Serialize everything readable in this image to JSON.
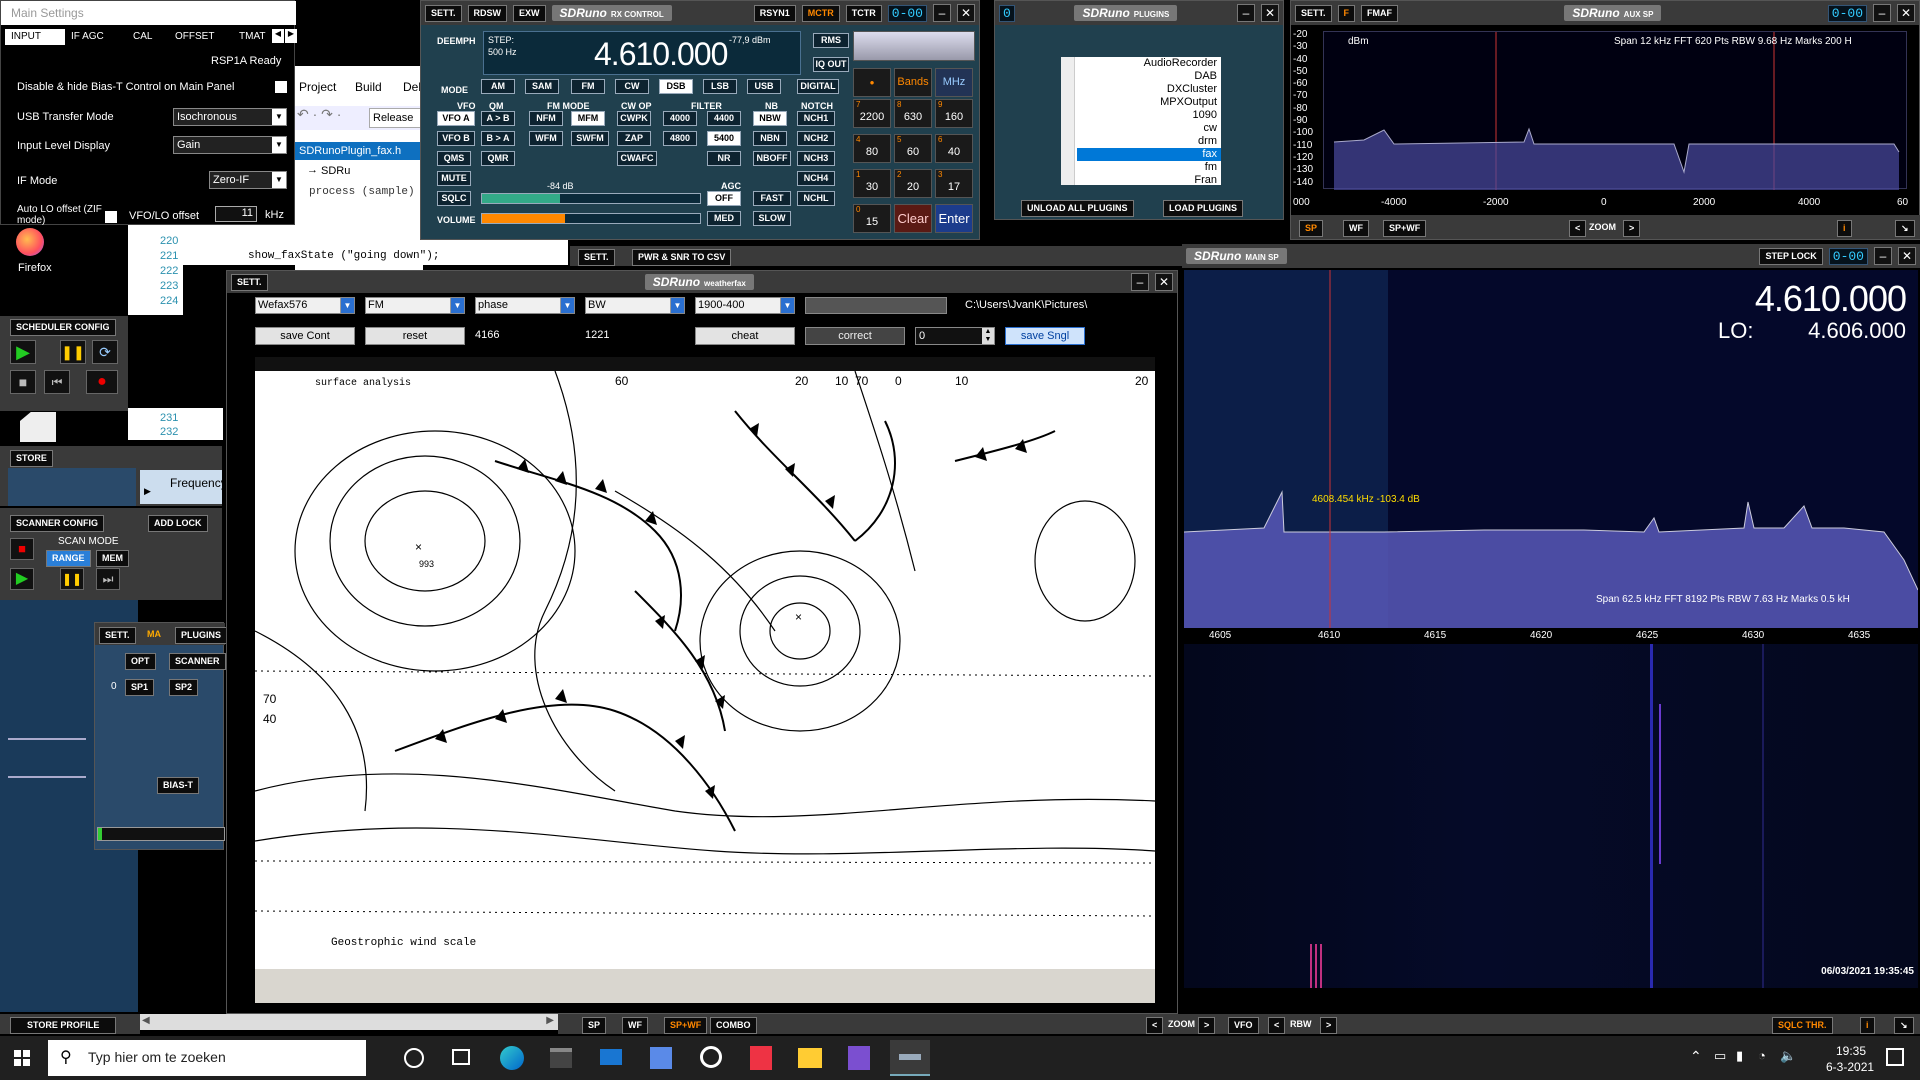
{
  "main_settings": {
    "title": "Main Settings",
    "tabs": [
      "INPUT",
      "IF AGC",
      "CAL",
      "OFFSET",
      "TMAT"
    ],
    "status": "RSP1A Ready",
    "bias_t_label": "Disable & hide Bias-T Control on Main Panel",
    "usb_mode_label": "USB Transfer Mode",
    "usb_mode_value": "Isochronous",
    "input_level_label": "Input Level Display",
    "input_level_value": "Gain",
    "if_mode_label": "IF Mode",
    "if_mode_value": "Zero-IF",
    "auto_lo_label": "Auto LO offset (ZIF mode)",
    "vfo_lo_label": "VFO/LO offset",
    "vfo_lo_value": "11",
    "vfo_lo_unit": "kHz"
  },
  "ide": {
    "menu": [
      "Project",
      "Build",
      "Deb"
    ],
    "config": "Release",
    "file_tab": "SDRunoPlugin_fax.h",
    "nav_item": "SDRu",
    "code_lines": [
      {
        "num": "",
        "text": "process (sample)"
      },
      {
        "num": "220",
        "text": ""
      },
      {
        "num": "221",
        "text": "show_faxState (\"going down\");"
      },
      {
        "num": "222",
        "text": ""
      },
      {
        "num": "223",
        "text": ""
      },
      {
        "num": "224",
        "text": ""
      }
    ],
    "more_lines": [
      "231",
      "232"
    ]
  },
  "desktop_icon": "Firefox",
  "left_panels": {
    "scheduler_title": "SCHEDULER CONFIG",
    "store_label": "STORE",
    "frequency_label": "Frequency",
    "scanner_title": "SCANNER CONFIG",
    "add_lock": "ADD LOCK",
    "scan_mode_label": "SCAN MODE",
    "range_label": "RANGE",
    "mem_label": "MEM",
    "store_profile": "STORE PROFILE"
  },
  "main_panel": {
    "sett": "SETT.",
    "ma": "MA",
    "plugins": "PLUGINS",
    "opt": "OPT",
    "scanner": "SCANNER",
    "zero": "0",
    "sp1": "SP1",
    "sp2": "SP2",
    "bias_t": "BIAS-T"
  },
  "rx_control": {
    "top_buttons": [
      "SETT.",
      "RDSW",
      "EXW"
    ],
    "logo": "SDRuno",
    "logo_sub": "RX CONTROL",
    "right_buttons": [
      "RSYN1",
      "MCTR",
      "TCTR"
    ],
    "lcd": "0-00",
    "deemph": "DEEMPH",
    "step_label": "STEP:",
    "step_value": "500 Hz",
    "frequency": "4.610.000",
    "signal": "-77,9 dBm",
    "rms": "RMS",
    "iq_out": "IQ OUT",
    "mode_label": "MODE",
    "modes": [
      "AM",
      "SAM",
      "FM",
      "CW",
      "DSB",
      "LSB",
      "USB",
      "DIGITAL"
    ],
    "vfo_label": "VFO",
    "qm_label": "QM",
    "fm_mode_label": "FM MODE",
    "cw_op_label": "CW OP",
    "filter_label": "FILTER",
    "nb_label": "NB",
    "notch_label": "NOTCH",
    "row1": [
      "VFO A",
      "A > B",
      "NFM",
      "MFM",
      "CWPK",
      "4000",
      "4400",
      "NBW",
      "NCH1"
    ],
    "row2": [
      "VFO B",
      "B > A",
      "WFM",
      "SWFM",
      "ZAP",
      "4800",
      "5400",
      "NBN",
      "NCH2"
    ],
    "row3": [
      "QMS",
      "QMR",
      "CWAFC",
      "NR",
      "NBOFF",
      "NCH3"
    ],
    "row4": [
      "MUTE",
      "NCH4"
    ],
    "sqlc": "SQLC",
    "sqlc_level": "-84 dB",
    "agc_label": "AGC",
    "agc_off": "OFF",
    "fast": "FAST",
    "nchl": "NCHL",
    "volume": "VOLUME",
    "med": "MED",
    "slow": "SLOW",
    "bands": "Bands",
    "mhz": "MHz",
    "keypad": [
      {
        "idx": "7",
        "val": "2200"
      },
      {
        "idx": "8",
        "val": "630"
      },
      {
        "idx": "9",
        "val": "160"
      },
      {
        "idx": "4",
        "val": "80"
      },
      {
        "idx": "5",
        "val": "60"
      },
      {
        "idx": "6",
        "val": "40"
      },
      {
        "idx": "1",
        "val": "30"
      },
      {
        "idx": "2",
        "val": "20"
      },
      {
        "idx": "3",
        "val": "17"
      },
      {
        "idx": "0",
        "val": "15"
      }
    ],
    "clear": "Clear",
    "enter": "Enter"
  },
  "plugins_win": {
    "logo": "SDRuno",
    "logo_sub": "PLUGINS",
    "lcd": "0",
    "list": [
      "AudioRecorder",
      "DAB",
      "DXCluster",
      "MPXOutput",
      "1090",
      "cw",
      "drm",
      "fax",
      "fm",
      "Fran"
    ],
    "selected": "fax",
    "unload": "UNLOAD ALL PLUGINS",
    "load": "LOAD PLUGINS"
  },
  "aux_sp": {
    "sett": "SETT.",
    "f": "F",
    "fmaf": "FMAF",
    "logo": "SDRuno",
    "logo_sub": "AUX SP",
    "lcd": "0-00",
    "db_label": "dBm",
    "yticks": [
      "-20",
      "-30",
      "-40",
      "-50",
      "-60",
      "-70",
      "-80",
      "-90",
      "-100",
      "-110",
      "-120",
      "-130",
      "-140"
    ],
    "info": "Span 12 kHz   FFT 620 Pts   RBW 9.68 Hz   Marks 200 H",
    "xticks": [
      "000",
      "-4000",
      "-2000",
      "0",
      "2000",
      "4000",
      "60"
    ],
    "sp": "SP",
    "wf": "WF",
    "spwf": "SP+WF",
    "zoom": "ZOOM",
    "i": "i"
  },
  "main_sp": {
    "logo": "SDRuno",
    "logo_sub": "MAIN SP",
    "step_lock": "STEP LOCK",
    "lcd": "0-00",
    "freq": "4.610.000",
    "lo_label": "LO:",
    "lo_freq": "4.606.000",
    "marker": "4608.454 kHz -103.4 dB",
    "info": "Span 62.5 kHz   FFT 8192 Pts   RBW 7.63 Hz   Marks 0.5 kH",
    "xticks": [
      "4605",
      "4610",
      "4615",
      "4620",
      "4625",
      "4630",
      "4635"
    ],
    "timestamp": "06/03/2021 19:35:45",
    "zoom": "ZOOM",
    "vfo": "VFO",
    "rbw": "RBW",
    "sqlc_thr": "SQLC THR.",
    "i": "i"
  },
  "center_bar": {
    "sett": "SETT.",
    "pwr": "PWR & SNR TO CSV",
    "sp": "SP",
    "wf": "WF",
    "spwf": "SP+WF",
    "combo": "COMBO"
  },
  "weatherfax": {
    "sett": "SETT.",
    "logo": "SDRuno",
    "logo_sub": "weatherfax",
    "selects": [
      "Wefax576",
      "FM",
      "phase",
      "BW",
      "1900-400"
    ],
    "path": "C:\\Users\\JvanK\\Pictures\\",
    "save_cont": "save Cont",
    "reset": "reset",
    "val1": "4166",
    "val2": "1221",
    "cheat": "cheat",
    "correct": "correct",
    "spin": "0",
    "save_sngl": "save Sngl",
    "chart_text": "Geostrophic wind scale",
    "chart_title": "surface analysis",
    "labels": [
      "60",
      "20",
      "10",
      "70",
      "0",
      "10",
      "20",
      "70",
      "40",
      "993"
    ]
  },
  "taskbar": {
    "search": "Typ hier om te zoeken",
    "time": "19:35",
    "date": "6-3-2021"
  }
}
